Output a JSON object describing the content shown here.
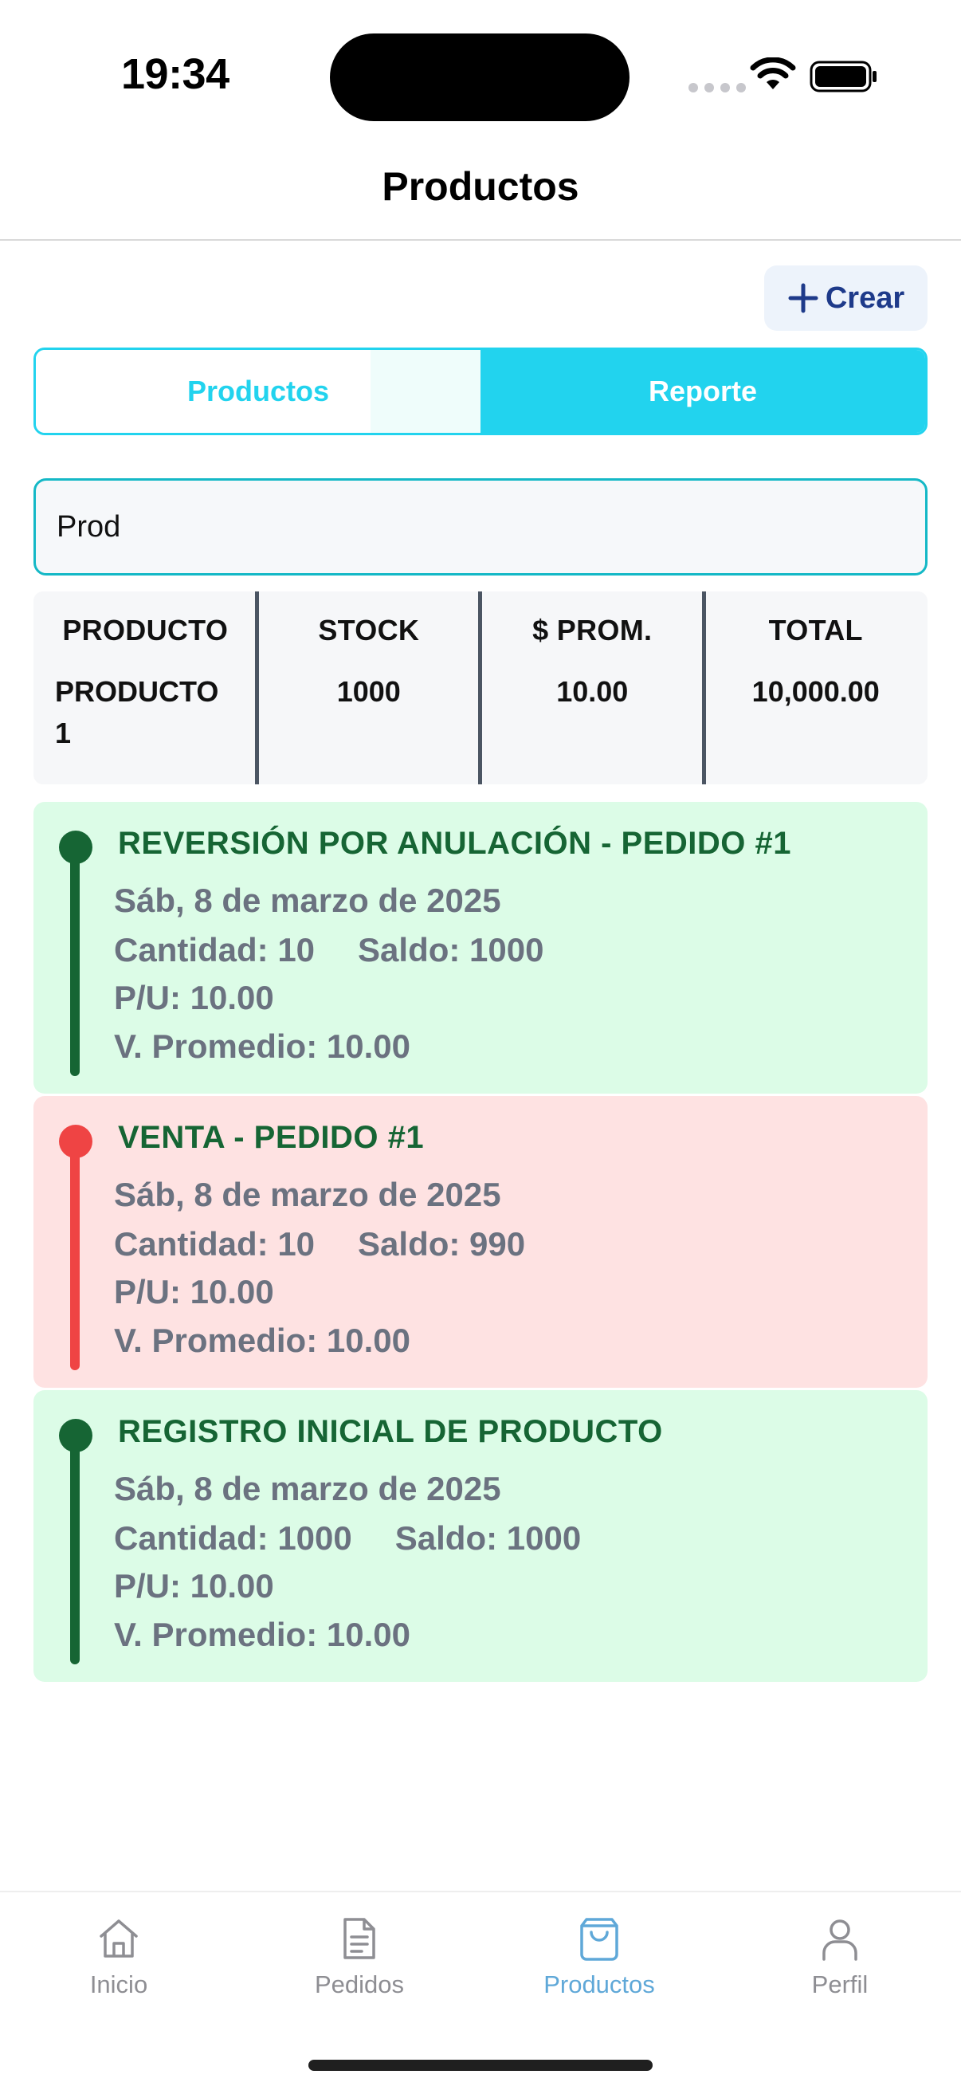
{
  "status_bar": {
    "time": "19:34",
    "icons": [
      "cellular-signal-icon",
      "wifi-icon",
      "battery-icon"
    ]
  },
  "header": {
    "title": "Productos"
  },
  "toolbar": {
    "create_label": "Crear",
    "create_icon": "plus-icon"
  },
  "tabs": [
    {
      "label": "Productos",
      "selected": false
    },
    {
      "label": "Reporte",
      "selected": true
    }
  ],
  "search": {
    "value": "Prod"
  },
  "summary": {
    "headers": [
      "PRODUCTO",
      "STOCK",
      "$ PROM.",
      "TOTAL"
    ],
    "row": [
      "PRODUCTO 1",
      "1000",
      "10.00",
      "10,000.00"
    ]
  },
  "movements": [
    {
      "title": "REVERSIÓN POR ANULACIÓN - PEDIDO #1",
      "date": "Sáb, 8 de marzo de 2025",
      "quantity": "Cantidad: 10",
      "balance": "Saldo: 1000",
      "unit_price": "P/U: 10.00",
      "average": "V. Promedio: 10.00",
      "kind": "entrada",
      "color": "#dcfce7"
    },
    {
      "title": "VENTA - PEDIDO #1",
      "date": "Sáb, 8 de marzo de 2025",
      "quantity": "Cantidad: 10",
      "balance": "Saldo: 990",
      "unit_price": "P/U: 10.00",
      "average": "V. Promedio: 10.00",
      "kind": "salida",
      "color": "#fee2e2"
    },
    {
      "title": "REGISTRO INICIAL DE PRODUCTO",
      "date": "Sáb, 8 de marzo de 2025",
      "quantity": "Cantidad: 1000",
      "balance": "Saldo: 1000",
      "unit_price": "P/U: 10.00",
      "average": "V. Promedio: 10.00",
      "kind": "entrada",
      "color": "#dcfce7"
    }
  ],
  "bottom_nav": [
    {
      "label": "Inicio",
      "icon": "home-icon",
      "active": false
    },
    {
      "label": "Pedidos",
      "icon": "document-icon",
      "active": false
    },
    {
      "label": "Productos",
      "icon": "shopping-bag-icon",
      "active": true
    },
    {
      "label": "Perfil",
      "icon": "person-icon",
      "active": false
    }
  ],
  "colors": {
    "accent": "#22d3ee",
    "entry_green": "#166534",
    "exit_red": "#ef4444",
    "active_nav": "#5fa8d8"
  }
}
